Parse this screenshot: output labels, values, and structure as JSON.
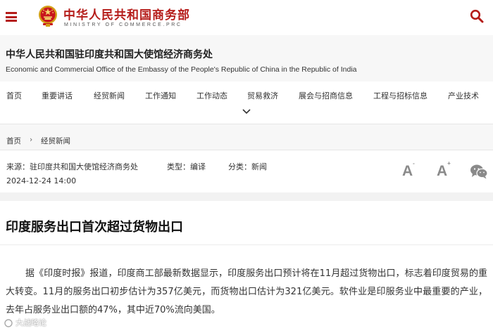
{
  "header": {
    "ministry_cn": "中华人民共和国商务部",
    "ministry_en": "MINISTRY OF COMMERCE.PRC",
    "brand_color": "#b51d1a",
    "icons": [
      "menu-icon",
      "national-emblem-icon",
      "search-icon"
    ]
  },
  "office": {
    "name_cn": "中华人民共和国驻印度共和国大使馆经济商务处",
    "name_en": "Economic and Commercial Office of the Embassy of the People's Republic of China in the Republic of India"
  },
  "nav": {
    "items": [
      "首页",
      "重要讲话",
      "经贸新闻",
      "工作通知",
      "工作动态",
      "贸易救济",
      "展会与招商信息",
      "工程与招标信息",
      "产业技术"
    ],
    "expand_icon": "chevron-down-icon"
  },
  "breadcrumb": {
    "items": [
      "首页",
      "经贸新闻"
    ],
    "separator": "›"
  },
  "meta": {
    "source": "来源：驻印度共和国大使馆经济商务处",
    "type": "类型：编译",
    "category": "分类：新闻",
    "date": "2024-12-24 14:00",
    "font_decrease": "A",
    "font_increase": "A",
    "font_decrease_sign": "-",
    "font_increase_sign": "+",
    "share_icon": "wechat-icon"
  },
  "article": {
    "title": "印度服务出口首次超过货物出口",
    "body": "据《印度时报》报道，印度商工部最新数据显示，印度服务出口预计将在11月超过货物出口，标志着印度贸易的重大转变。11月的服务出口初步估计为357亿美元，而货物出口估计为321亿美元。软件业是印服务业中最重要的产业，去年占服务业出口额的47%，其中近70%流向美国。"
  },
  "watermark": {
    "text": "大战略论"
  }
}
